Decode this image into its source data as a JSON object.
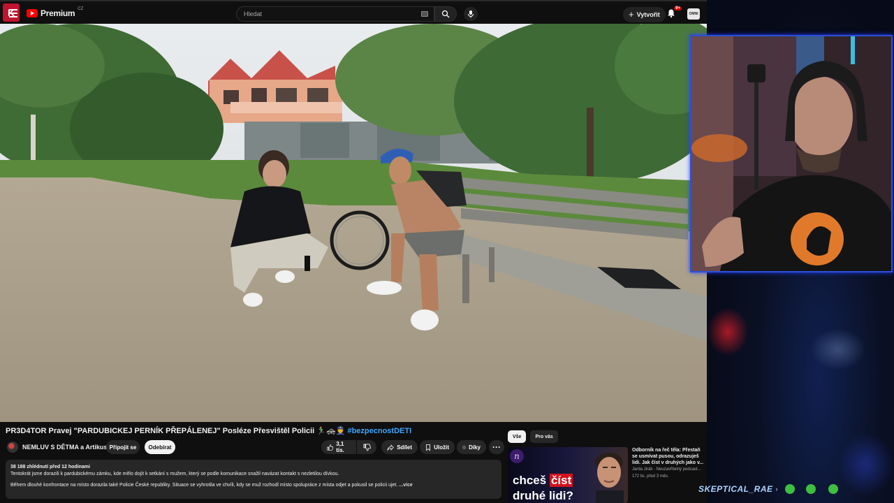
{
  "header": {
    "ext_logo": "K",
    "logo_text": "Premium",
    "logo_country": "CZ",
    "search_placeholder": "Hledat",
    "create_label": "Vytvořit",
    "notifications_badge": "9+",
    "account_label": "OMNI"
  },
  "video": {
    "title": "PR3D4TOR Pravej \"PARDUBICKEJ PERNÍK PŘEPÁLENEJ\" Posléze Přesvištěl Policii",
    "title_emojis": "🏃‍♂️🚓👮",
    "hashtag": "#bezpecnostDETI",
    "channel_name": "NEMLUV S DĚTMA a Artikus",
    "join_label": "Připojit se",
    "subscribe_label": "Odebírat",
    "likes_label": "3,1 tis.",
    "share_label": "Sdílet",
    "save_label": "Uložit",
    "thanks_label": "Díky"
  },
  "description": {
    "stats": "38 188 zhlédnutí  před 12 hodinami",
    "line1": "Tentokrát jsme dorazili k pardubickému zámku, kde mělo dojít k setkání s mužem, který se podle komunikace snažil navázat kontakt s nezletilou dívkou.",
    "line2": "Během dlouhé konfrontace na místo dorazila také Policie České republiky. Situace se vyhrotila ve chvíli, kdy se muž rozhodl místo spolupráce z místa odjet a pokusil se policii ujet.",
    "more": "...více"
  },
  "sidebar": {
    "chips": [
      "Vše",
      "Pro vás"
    ],
    "recommendation": {
      "thumb_line1_prefix": "chceš",
      "thumb_line1_highlight": "číst",
      "thumb_line2": "druhé lidi?",
      "title": "Odborník na řeč těla: Přestaň se usmívat pusou, odrazuješ lidi. Jak číst v druhých jako v...",
      "channel": "Jarda Jirák - Neuzavřitelný podcast...",
      "meta": "172 tis.  před 3 měs."
    }
  },
  "stream": {
    "streamer_name": "SKEPTICAL_RAE"
  },
  "colors": {
    "accent_red": "#ff0000",
    "link_blue": "#3ea6ff",
    "webcam_border": "#2d4fd8"
  }
}
